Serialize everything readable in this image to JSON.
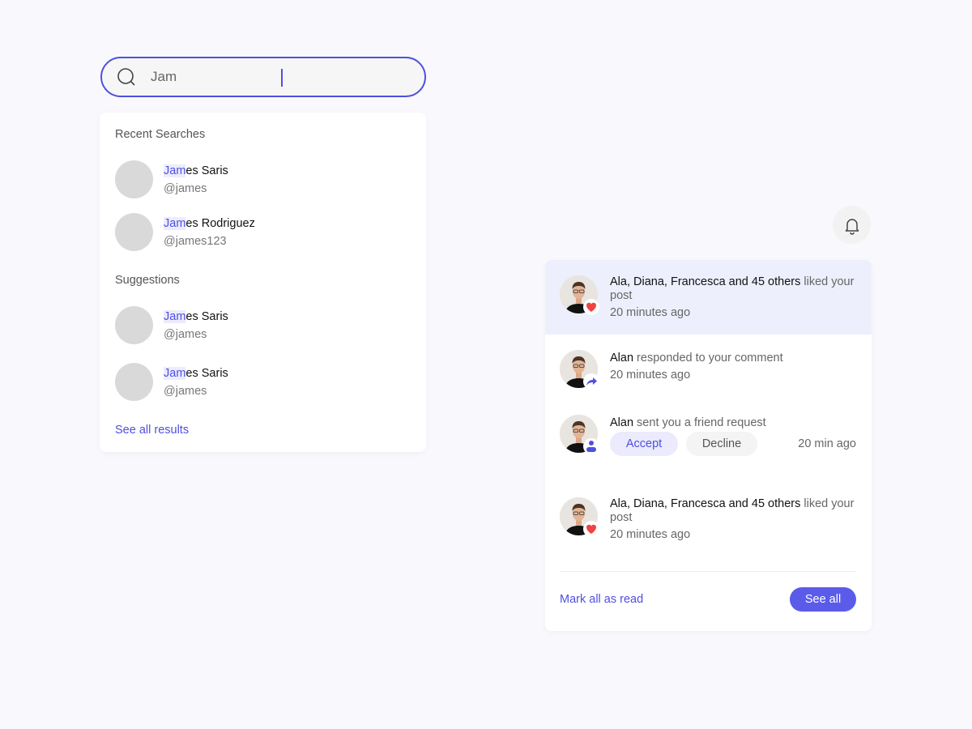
{
  "search": {
    "value": "Jam",
    "icon": "search-icon"
  },
  "dropdown": {
    "recent_title": "Recent Searches",
    "recent": [
      {
        "match": "Jam",
        "rest": "es Saris",
        "handle": "@james"
      },
      {
        "match": "Jam",
        "rest": "es Rodriguez",
        "handle": "@james123"
      }
    ],
    "suggestions_title": "Suggestions",
    "suggestions": [
      {
        "match": "Jam",
        "rest": "es Saris",
        "handle": "@james"
      },
      {
        "match": "Jam",
        "rest": "es Saris",
        "handle": "@james"
      }
    ],
    "see_all": "See all results"
  },
  "bell": {
    "icon": "bell-icon"
  },
  "notifications": {
    "items": [
      {
        "actor": "Ala, Diana, Francesca and 45 others",
        "text": " liked your post",
        "time": "20 minutes ago",
        "badge": "heart-icon",
        "unread": true
      },
      {
        "actor": "Alan",
        "text": " responded to your comment",
        "time": "20 minutes ago",
        "badge": "reply-icon",
        "unread": false
      },
      {
        "actor": "Alan",
        "text": " sent you a friend request",
        "time": "20 min ago",
        "badge": "user-add-icon",
        "unread": false,
        "accept": "Accept",
        "decline": "Decline"
      },
      {
        "actor": "Ala, Diana, Francesca and 45 others",
        "text": " liked your post",
        "time": "20 minutes ago",
        "badge": "heart-icon",
        "unread": false
      }
    ],
    "mark_all": "Mark all as read",
    "see_all": "See all"
  },
  "colors": {
    "accent": "#4f4fe0",
    "button": "#5b5bea",
    "heart": "#ef4444",
    "unread_bg": "#eeeffd"
  }
}
